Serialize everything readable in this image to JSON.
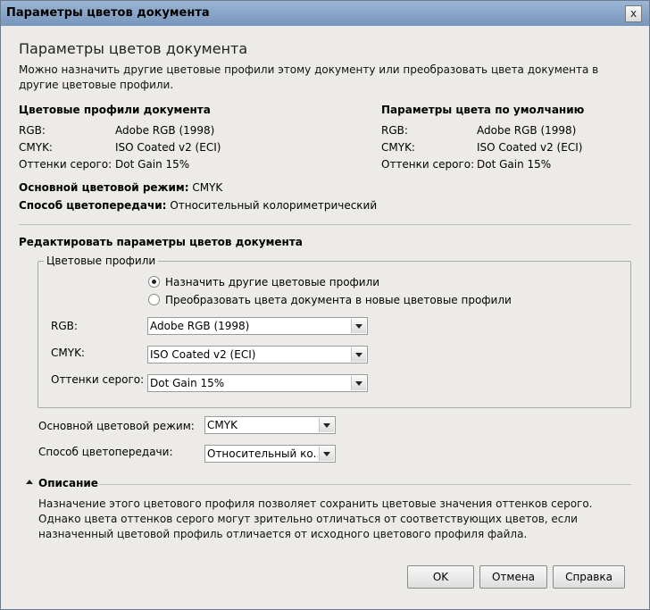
{
  "window": {
    "title": "Параметры цветов документа",
    "close_label": "x"
  },
  "heading": "Параметры цветов документа",
  "intro": "Можно назначить другие цветовые профили этому документу или преобразовать цвета документа в другие цветовые профили.",
  "doc_profiles": {
    "title": "Цветовые профили документа",
    "rows": [
      {
        "label": "RGB:",
        "value": "Adobe RGB (1998)"
      },
      {
        "label": "CMYK:",
        "value": "ISO Coated v2 (ECI)"
      },
      {
        "label": "Оттенки серого:",
        "value": "Dot Gain 15%"
      }
    ]
  },
  "defaults": {
    "title": "Параметры цвета по умолчанию",
    "rows": [
      {
        "label": "RGB:",
        "value": "Adobe RGB (1998)"
      },
      {
        "label": "CMYK:",
        "value": "ISO Coated v2 (ECI)"
      },
      {
        "label": "Оттенки серого:",
        "value": "Dot Gain 15%"
      }
    ]
  },
  "mode": {
    "label": "Основной цветовой режим:",
    "value": "CMYK"
  },
  "intent": {
    "label": "Способ цветопередачи:",
    "value": "Относительный колориметрический"
  },
  "edit": {
    "title": "Редактировать параметры цветов документа",
    "group_legend": "Цветовые профили",
    "radio_assign": "Назначить другие цветовые профили",
    "radio_convert": "Преобразовать цвета документа в новые цветовые профили",
    "rgb_label": "RGB:",
    "rgb_value": "Adobe RGB (1998)",
    "cmyk_label": "CMYK:",
    "cmyk_value": "ISO Coated v2 (ECI)",
    "gray_label": "Оттенки серого:",
    "gray_value": "Dot Gain 15%",
    "mode_label": "Основной цветовой режим:",
    "mode_value": "CMYK",
    "intent_label": "Способ цветопередачи:",
    "intent_value": "Относительный ко..."
  },
  "description": {
    "title": "Описание",
    "text": "Назначение этого цветового профиля позволяет сохранить цветовые значения оттенков серого. Однако цвета оттенков серого могут зрительно отличаться от соответствующих цветов, если назначенный цветовой профиль отличается от исходного цветового профиля файла."
  },
  "buttons": {
    "ok": "OK",
    "cancel": "Отмена",
    "help": "Справка"
  }
}
